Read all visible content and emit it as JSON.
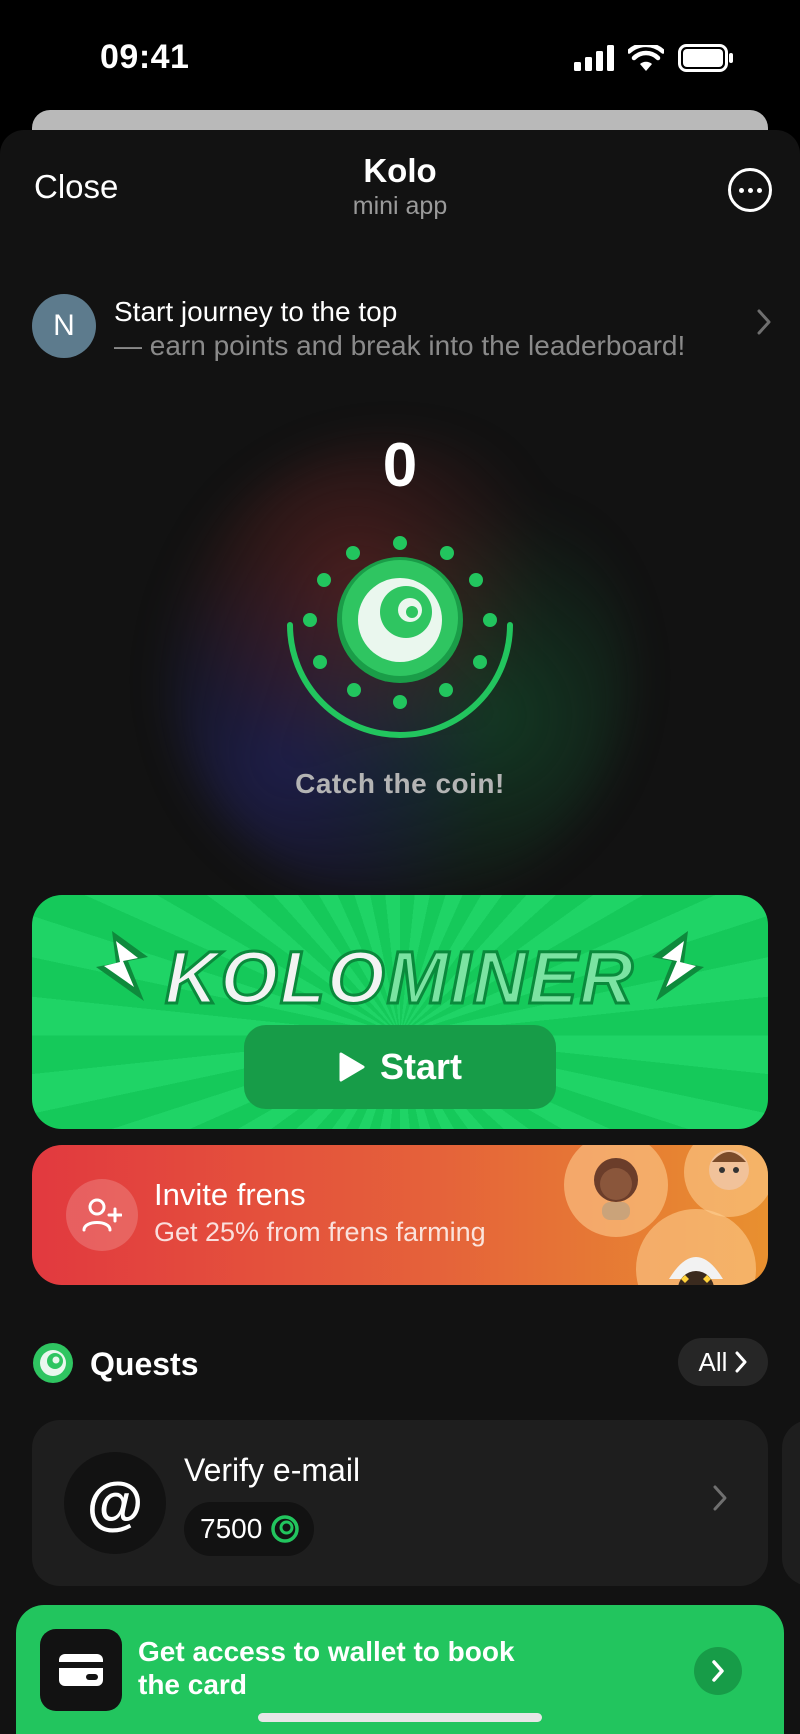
{
  "status_bar": {
    "time": "09:41"
  },
  "header": {
    "close_label": "Close",
    "title": "Kolo",
    "subtitle": "mini app"
  },
  "journey": {
    "avatar_letter": "N",
    "title": "Start journey to the top",
    "subtitle": "— earn points and break into the leaderboard!"
  },
  "game": {
    "score": "0",
    "hint": "Catch the coin!"
  },
  "miner": {
    "title_part1": "KOLO",
    "title_part2": "MINER",
    "start_label": "Start"
  },
  "invite": {
    "title": "Invite frens",
    "subtitle": "Get 25% from frens farming"
  },
  "quests": {
    "title": "Quests",
    "all_label": "All",
    "items": [
      {
        "icon": "@",
        "title": "Verify e-mail",
        "reward": "7500"
      }
    ]
  },
  "wallet": {
    "text": "Get access to wallet to book the card"
  },
  "colors": {
    "accent_green": "#22c55e",
    "invite_start": "#e2393f",
    "invite_end": "#e8902f",
    "background": "#121212"
  },
  "icons": [
    "signal-icon",
    "wifi-icon",
    "battery-icon",
    "more-icon",
    "chevron-right-icon",
    "kolo-coin-icon",
    "lightning-icon",
    "play-icon",
    "add-user-icon",
    "card-icon"
  ]
}
